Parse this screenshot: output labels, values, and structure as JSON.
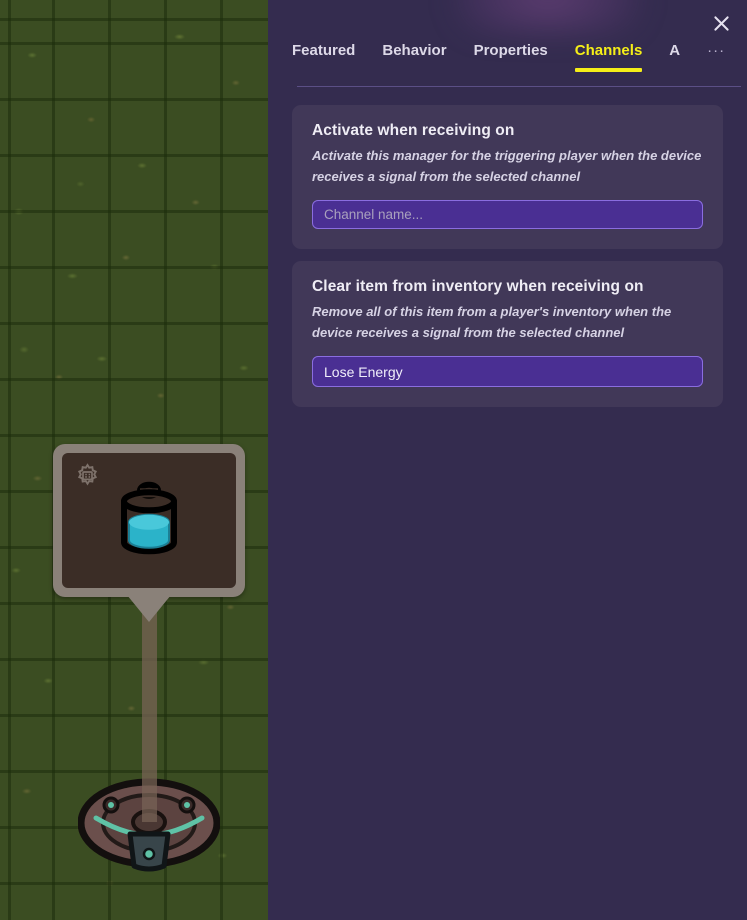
{
  "panel": {
    "close_icon": "close-icon",
    "overflow_icon": "ellipsis-icon",
    "overflow_label": "···",
    "accent_color": "#f5ee18",
    "background_color": "#342c4f",
    "card_color": "#413858",
    "input_fill_color": "#4a2f93",
    "input_border_color": "#8a6de0"
  },
  "tabs": [
    {
      "label": "Featured",
      "active": false
    },
    {
      "label": "Behavior",
      "active": false
    },
    {
      "label": "Properties",
      "active": false
    },
    {
      "label": "Channels",
      "active": true
    },
    {
      "label": "A",
      "active": false
    }
  ],
  "cards": [
    {
      "title": "Activate when receiving on",
      "description": "Activate this manager for the triggering player when the device receives a signal from the selected channel",
      "input": {
        "value": "",
        "placeholder": "Channel name..."
      }
    },
    {
      "title": "Clear item from inventory when receiving on",
      "description": "Remove all of this item from a player's inventory when the device receives a signal from the selected channel",
      "input": {
        "value": "Lose Energy",
        "placeholder": "Channel name..."
      }
    }
  ],
  "world": {
    "device_icon": "energy-container-icon",
    "settings_icon": "gear-icon",
    "grass_color": "#3b4d22",
    "grid_color": "#1c2c0c",
    "sign_frame_color": "#8a8179",
    "sign_face_color": "#3b2d26",
    "liquid_color": "#2bb3c9"
  }
}
